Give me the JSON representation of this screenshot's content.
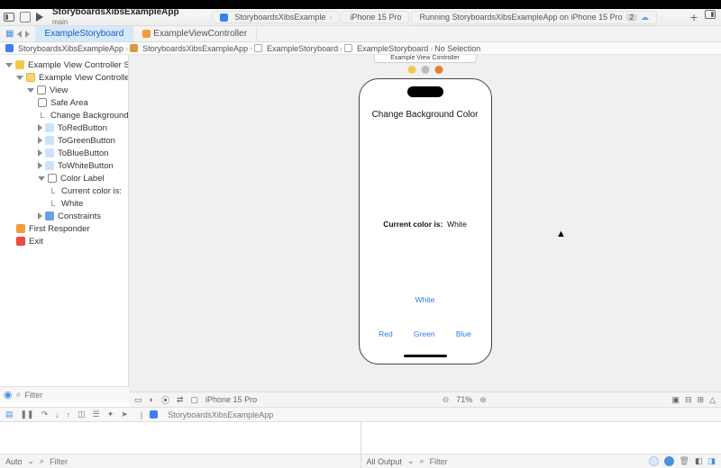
{
  "toolbar": {
    "project_name": "StoryboardsXibsExampleApp",
    "branch": "main",
    "scheme": "StoryboardsXibsExample",
    "device": "iPhone 15 Pro",
    "status": "Running StoryboardsXibsExampleApp on iPhone 15 Pro",
    "issue_count": "2"
  },
  "tabs": {
    "active": "ExampleStoryboard",
    "second": "ExampleViewController"
  },
  "crumbs": {
    "c0": "StoryboardsXibsExampleApp",
    "c1": "StoryboardsXibsExampleApp",
    "c2": "ExampleStoryboard",
    "c3": "ExampleStoryboard",
    "c4": "No Selection"
  },
  "outline": {
    "scene": "Example View Controller Scene",
    "vc": "Example View Controller",
    "view": "View",
    "safe": "Safe Area",
    "label_title": "Change Background Col...",
    "btn_red": "ToRedButton",
    "btn_green": "ToGreenButton",
    "btn_blue": "ToBlueButton",
    "btn_white": "ToWhiteButton",
    "color_label": "Color Label",
    "cl_current": "Current color is:",
    "cl_white": "White",
    "constraints": "Constraints",
    "first_resp": "First Responder",
    "exit": "Exit",
    "filter_ph": "Filter"
  },
  "phone": {
    "scene_label": "Example View Controller",
    "title": "Change Background Color",
    "status_prefix": "Current color is:",
    "status_value": "White",
    "btn_white": "White",
    "btn_red": "Red",
    "btn_green": "Green",
    "btn_blue": "Blue"
  },
  "canvas_bar": {
    "device": "iPhone 15 Pro",
    "zoom": "71%"
  },
  "debug": {
    "target": "StoryboardsXibsExampleApp"
  },
  "bottom": {
    "auto": "Auto",
    "all_output": "All Output",
    "filter_ph": "Filter"
  }
}
